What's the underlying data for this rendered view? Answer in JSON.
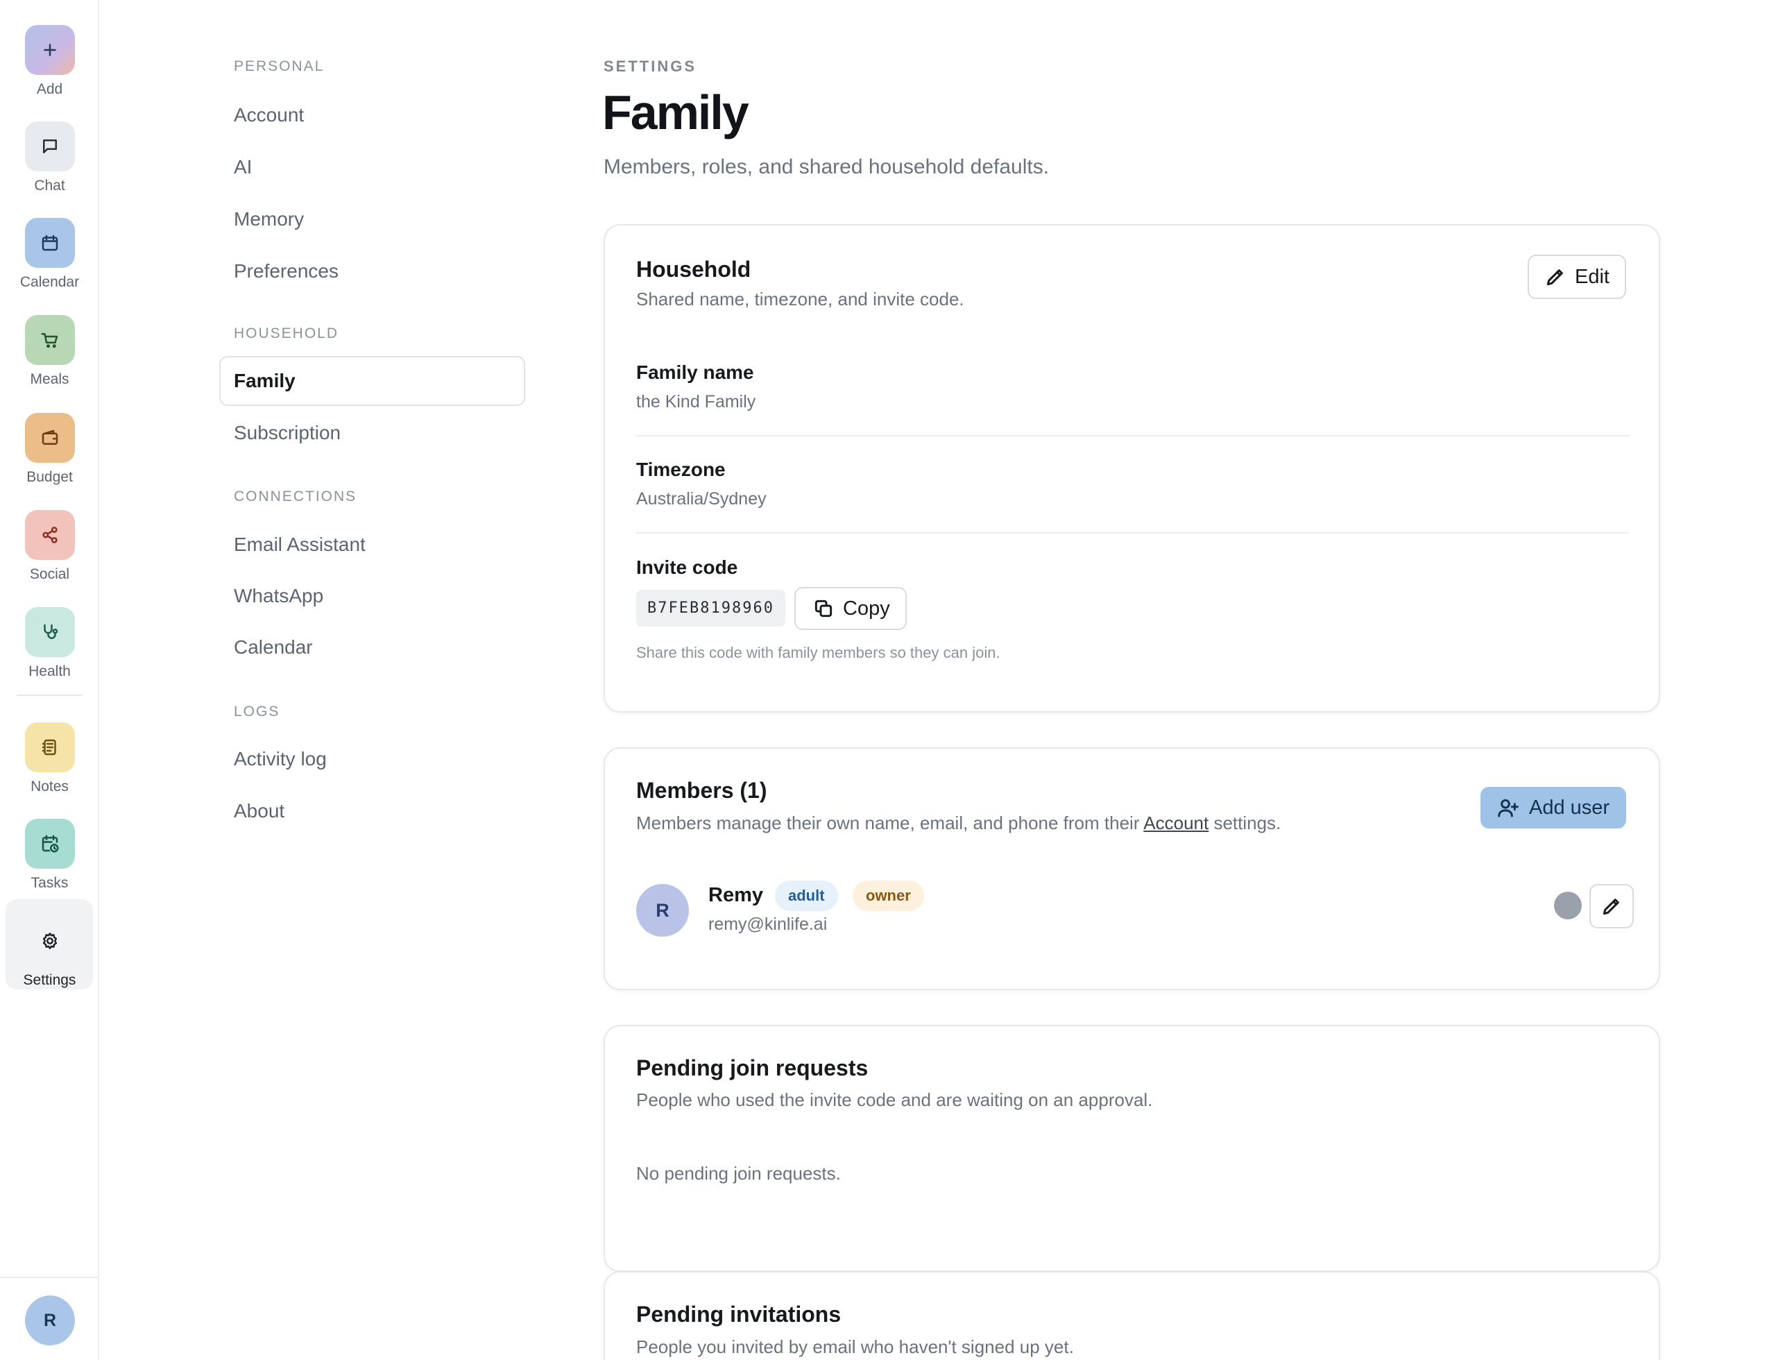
{
  "rail": {
    "items": [
      {
        "label": "Add",
        "icon": "plus-icon",
        "bg": "linear"
      },
      {
        "label": "Chat",
        "icon": "chat-bubble-icon",
        "bg": "#e7ebf0"
      },
      {
        "label": "Calendar",
        "icon": "calendar-icon",
        "bg": "#a9c6e8"
      },
      {
        "label": "Meals",
        "icon": "cart-icon",
        "bg": "#b8d8b5"
      },
      {
        "label": "Budget",
        "icon": "wallet-icon",
        "bg": "#ebbd88"
      },
      {
        "label": "Social",
        "icon": "share-icon",
        "bg": "#f2c3bb"
      },
      {
        "label": "Health",
        "icon": "stethoscope-icon",
        "bg": "#c9e8df"
      },
      {
        "label": "Notes",
        "icon": "notebook-icon",
        "bg": "#f6e3a8"
      },
      {
        "label": "Tasks",
        "icon": "calendar-clock-icon",
        "bg": "#a7dcd2"
      },
      {
        "label": "Settings",
        "icon": "gear-icon",
        "bg": "#f1f2f4"
      }
    ],
    "avatar_initial": "R"
  },
  "nav": {
    "sections": [
      {
        "heading": "PERSONAL",
        "items": [
          "Account",
          "AI",
          "Memory",
          "Preferences"
        ]
      },
      {
        "heading": "HOUSEHOLD",
        "items": [
          "Family",
          "Subscription"
        ]
      },
      {
        "heading": "CONNECTIONS",
        "items": [
          "Email Assistant",
          "WhatsApp",
          "Calendar"
        ]
      },
      {
        "heading": "LOGS",
        "items": [
          "Activity log",
          "About"
        ]
      }
    ],
    "active": "Family"
  },
  "header": {
    "eyebrow": "SETTINGS",
    "title": "Family",
    "subtitle": "Members, roles, and shared household defaults."
  },
  "household": {
    "title": "Household",
    "subtitle": "Shared name, timezone, and invite code.",
    "edit_label": "Edit",
    "family_name_label": "Family name",
    "family_name_value": "the Kind Family",
    "timezone_label": "Timezone",
    "timezone_value": "Australia/Sydney",
    "invite_label": "Invite code",
    "invite_code": "B7FEB8198960",
    "copy_label": "Copy",
    "invite_hint": "Share this code with family members so they can join."
  },
  "members": {
    "title": "Members (1)",
    "subtitle_before": "Members manage their own name, email, and phone from their ",
    "subtitle_link": "Account",
    "subtitle_after": " settings.",
    "add_user_label": "Add user",
    "list": [
      {
        "initial": "R",
        "name": "Remy",
        "email": "remy@kinlife.ai",
        "badges": [
          "adult",
          "owner"
        ]
      }
    ]
  },
  "pending_requests": {
    "title": "Pending join requests",
    "subtitle": "People who used the invite code and are waiting on an approval.",
    "empty": "No pending join requests."
  },
  "pending_invitations": {
    "title": "Pending invitations",
    "subtitle": "People you invited by email who haven't signed up yet."
  }
}
